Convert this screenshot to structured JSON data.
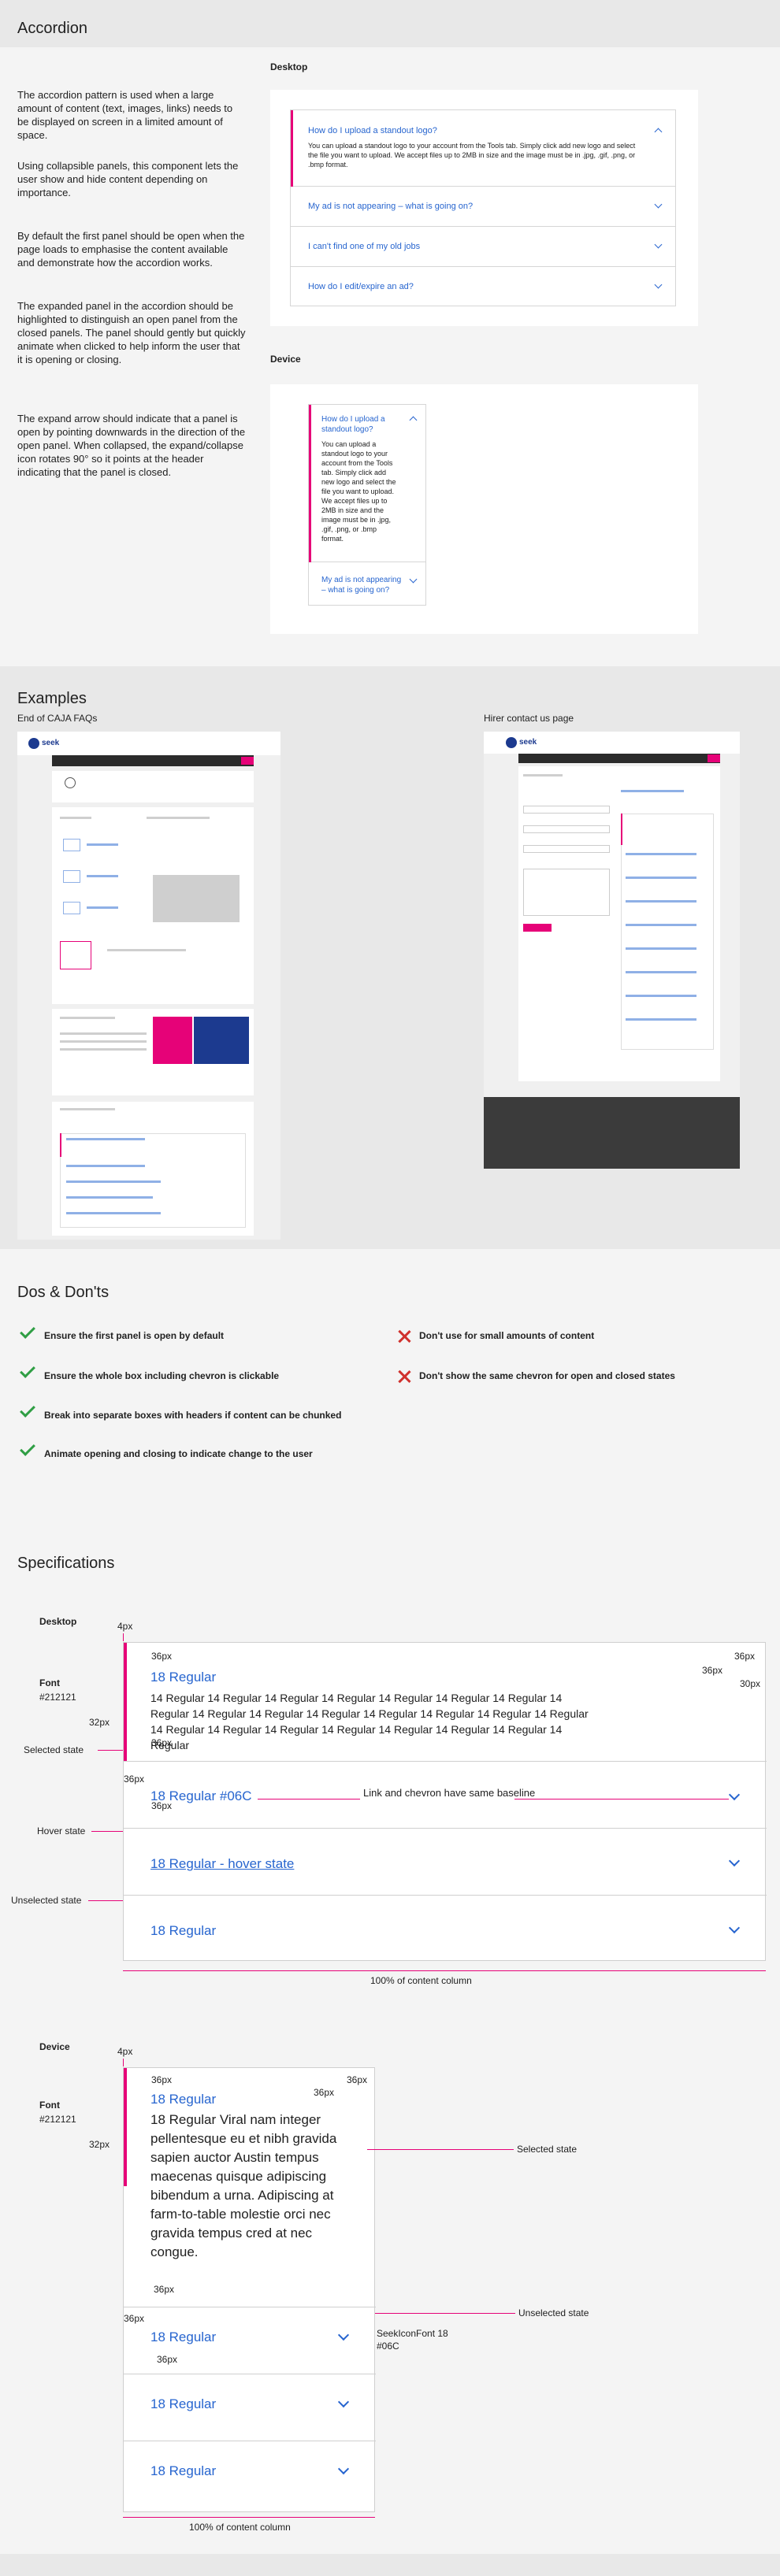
{
  "accordion": {
    "title": "Accordion",
    "desc1": "The accordion pattern is used when a large amount of content (text, images, links) needs to be displayed on screen in a limited amount of space.",
    "desc2": "Using collapsible panels, this component lets the user show and hide content depending on importance.",
    "desc3": "By default the first panel should be open when the page loads to emphasise the content available and demonstrate how the accordion works.",
    "desc4": "The expanded panel in the accordion should be highlighted to distinguish an open panel from the closed panels. The panel should gently but quickly animate when clicked to help inform the user that it is opening or closing.",
    "desc5": "The expand arrow should indicate that a panel is open by pointing downwards in the direction of the open panel. When collapsed, the expand/collapse icon rotates 90° so it points at the header indicating that the panel is closed.",
    "desktop_label": "Desktop",
    "device_label": "Device",
    "desktop_items": [
      "How do I upload a standout logo?",
      "My ad is not appearing – what is going on?",
      "I can't find one of my old jobs",
      "How do I edit/expire an ad?"
    ],
    "desktop_answer": "You can upload a standout logo to your account from the Tools tab. Simply click add new logo and select the file you want to upload. We accept files up to 2MB in size and the image must be in .jpg, .gif, .png, or .bmp format.",
    "device_items": [
      "How do I upload a standout logo?",
      "My ad is not appearing – what is going on?"
    ],
    "device_answer": "You can upload a standout logo to your account from the Tools tab. Simply click add new logo and select the file you want to upload. We accept files up to 2MB in size and the image must be in .jpg, .gif, .png, or .bmp format."
  },
  "examples": {
    "title": "Examples",
    "left_caption": "End of CAJA FAQs",
    "right_caption": "Hirer contact us page",
    "brand": "seek"
  },
  "dos": {
    "title": "Dos & Don'ts",
    "do_items": [
      "Ensure the first panel is open by default",
      "Ensure the whole box including chevron is clickable",
      "Break into separate boxes with headers if content can be chunked",
      "Animate opening and closing to indicate change to the user"
    ],
    "dont_items": [
      "Don't use for small amounts of content",
      "Don't show the same chevron for open and closed states"
    ]
  },
  "specs": {
    "title": "Specifications",
    "desktop_label": "Desktop",
    "device_label": "Device",
    "font_label": "Font",
    "font_color": "#212121",
    "m4": "4px",
    "m36": "36px",
    "m32": "32px",
    "m30": "30px",
    "selected_state": "Selected state",
    "hover_state": "Hover state",
    "unselected_state": "Unselected state",
    "d_title": "18 Regular",
    "d_body": "14 Regular 14 Regular 14 Regular 14 Regular 14 Regular 14 Regular 14 Regular 14 Regular 14 Regular 14 Regular 14 Regular 14 Regular 14 Regular 14 Regular 14 Regular 14 Regular 14 Regular 14 Regular 14 Regular 14 Regular 14 Regular 14 Regular 14 Regular",
    "d_row2": "18 Regular #06C",
    "baseline_note": "Link and chevron have same baseline",
    "d_row3": "18 Regular - hover state",
    "d_row4": "18 Regular",
    "full_width": "100% of content column",
    "m_title": "18 Regular",
    "m_body": "18 Regular Viral nam integer pellentesque eu et nibh gravida sapien auctor Austin tempus maecenas quisque adipiscing bibendum a urna. Adipiscing at farm-to-table molestie orci nec gravida tempus cred at nec congue.",
    "m_row2": "18 Regular",
    "m_row3": "18 Regular",
    "m_row4": "18 Regular",
    "icon_note1": "SeekIconFont 18",
    "icon_note2": "#06C",
    "accent": "#e60278",
    "link": "#2765cf"
  }
}
